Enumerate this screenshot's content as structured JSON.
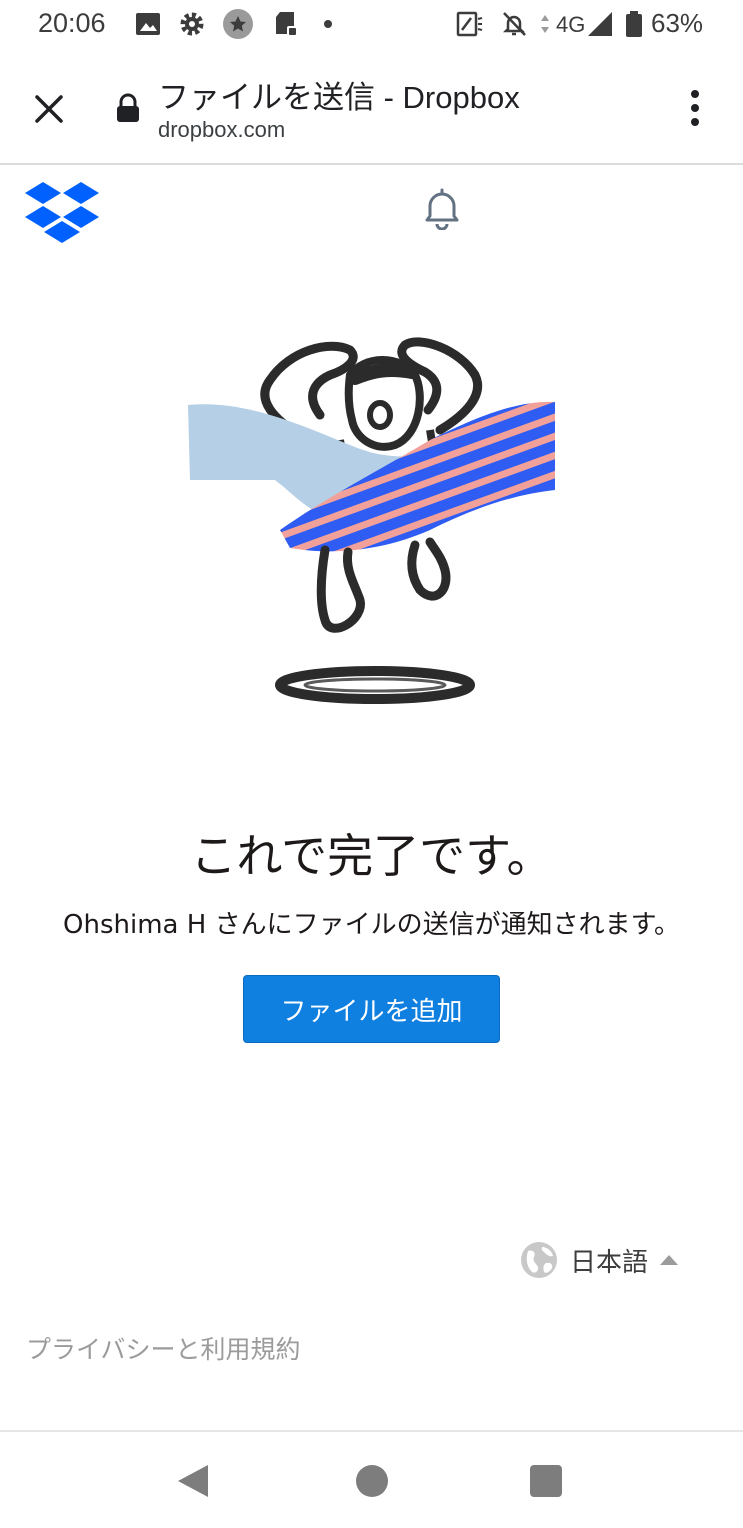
{
  "status_bar": {
    "time": "20:06",
    "network": "4G",
    "battery": "63%",
    "icons": [
      "image-icon",
      "gear-icon",
      "star-badge-icon",
      "sd-card-icon",
      "dot-icon",
      "nfc-icon",
      "muted-bell-icon",
      "data-arrows-icon",
      "signal-icon",
      "battery-icon"
    ]
  },
  "browser": {
    "title": "ファイルを送信 - Dropbox",
    "url": "dropbox.com",
    "icons": [
      "close-icon",
      "lock-icon",
      "more-vert-icon"
    ]
  },
  "header": {
    "icons": [
      "dropbox-logo-icon",
      "bell-icon"
    ]
  },
  "main": {
    "illustration_icon": "jumping-person-banner-illustration",
    "title": "これで完了です。",
    "notice": "Ohshima H さんにファイルの送信が通知されます。",
    "add_files_label": "ファイルを追加"
  },
  "footer": {
    "language": "日本語",
    "privacy_link": "プライバシーと利用規約"
  },
  "nav_bar": {
    "icons": [
      "back-icon",
      "home-icon",
      "recents-icon"
    ]
  },
  "colors": {
    "primary_button": "#0f7fe0",
    "dropbox_blue": "#0061fe",
    "text": "#1e1919",
    "muted_text": "#9b9b9b",
    "banner_light_blue": "#b4cfe6",
    "banner_pink": "#f2a19a"
  }
}
